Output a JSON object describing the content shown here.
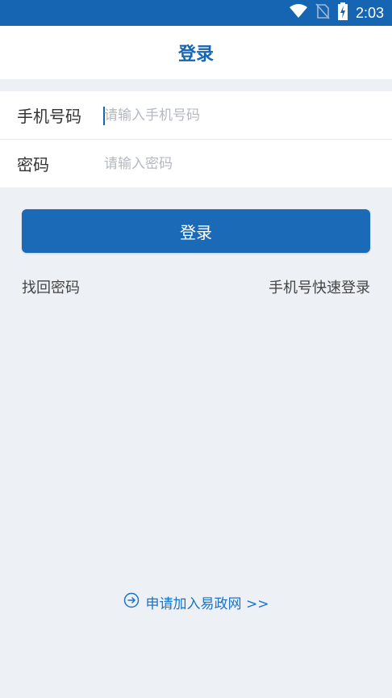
{
  "status_bar": {
    "time": "2:03",
    "icons": [
      "wifi-icon",
      "no-sim-icon",
      "battery-charging-icon"
    ],
    "color": "#1565b3"
  },
  "header": {
    "title": "登录"
  },
  "form": {
    "phone": {
      "label": "手机号码",
      "placeholder": "请输入手机号码",
      "value": ""
    },
    "password": {
      "label": "密码",
      "placeholder": "请输入密码",
      "value": ""
    }
  },
  "login_button": {
    "label": "登录",
    "color": "#1b6ab8"
  },
  "links": {
    "forgot_password": "找回密码",
    "quick_login": "手机号快速登录"
  },
  "apply": {
    "label": "申请加入易政网 >>",
    "icon": "arrow-circle-right-icon"
  }
}
